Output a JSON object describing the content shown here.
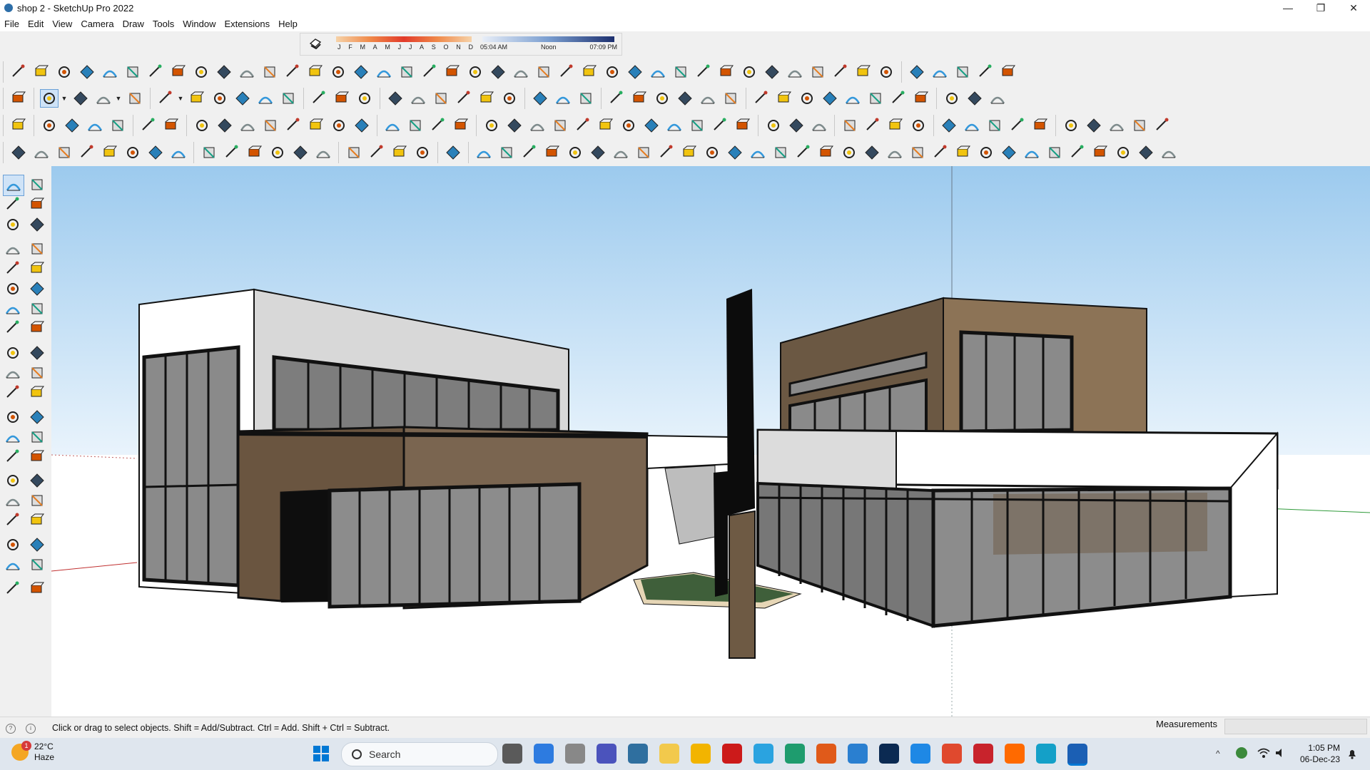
{
  "window": {
    "title": "shop 2 - SketchUp Pro 2022",
    "controls": [
      "—",
      "❐",
      "✕"
    ]
  },
  "menu": [
    "File",
    "Edit",
    "View",
    "Camera",
    "Draw",
    "Tools",
    "Window",
    "Extensions",
    "Help"
  ],
  "shadow_settings": {
    "months": [
      "J",
      "F",
      "M",
      "A",
      "M",
      "J",
      "J",
      "A",
      "S",
      "O",
      "N",
      "D"
    ],
    "sunrise": "05:04 AM",
    "noon": "Noon",
    "sunset": "07:09 PM"
  },
  "toolbars": {
    "row1_count": 44,
    "row2_count": 40,
    "row3_count": 48,
    "row4_count": 50,
    "selected_tool": "select"
  },
  "left_palette": {
    "tools": [
      "select",
      "orbit",
      "paint-bucket",
      "eraser",
      "component",
      "tape-measure",
      "line",
      "freehand",
      "rectangle",
      "rotated-rectangle",
      "circle",
      "polygon",
      "arc",
      "arc-2pt",
      "pie",
      "arc-3pt",
      "move",
      "push-pull",
      "rotate",
      "follow-me",
      "scale",
      "offset",
      "tape",
      "dimension",
      "protractor",
      "text",
      "axes",
      "3d-text",
      "orbit",
      "pan",
      "zoom",
      "zoom-window",
      "zoom-extents",
      "position-camera",
      "walk",
      "look-around",
      "section-plane",
      "section-display",
      "section-fill",
      "section-cuts"
    ]
  },
  "status": {
    "hint": "Click or drag to select objects. Shift = Add/Subtract. Ctrl = Add. Shift + Ctrl = Subtract.",
    "measurements_label": "Measurements",
    "measurements_value": ""
  },
  "taskbar": {
    "weather_temp": "22°C",
    "weather_desc": "Haze",
    "weather_badge": "1",
    "search_label": "Search",
    "time": "1:05 PM",
    "date": "06-Dec-23",
    "apps": [
      "start",
      "task-view",
      "photos",
      "files",
      "teams",
      "calculator",
      "sticky-notes",
      "explorer",
      "opera",
      "telegram",
      "pycharm",
      "g-app",
      "vscode",
      "photoshop",
      "drive",
      "chrome",
      "pinterest",
      "soundcloud",
      "app-3",
      "sketchup"
    ]
  },
  "colors": {
    "sky_top": "#9cc9ec",
    "sky_bottom": "#e6f2fb",
    "accent": "#0078d4"
  }
}
